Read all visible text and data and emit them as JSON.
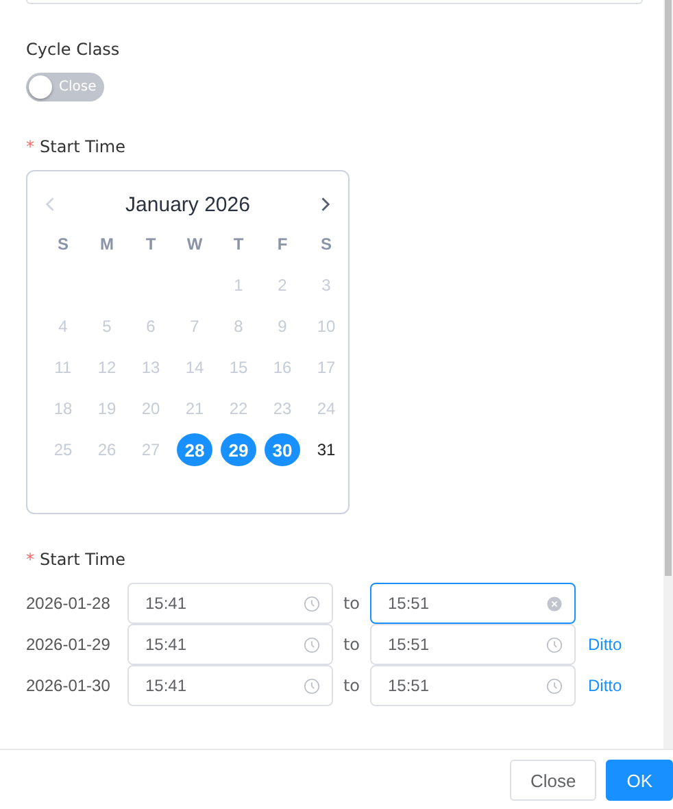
{
  "cycle_class": {
    "label": "Cycle Class",
    "toggle": {
      "label": "Close",
      "on": false
    }
  },
  "start_date": {
    "label": "Start Time",
    "required_mark": "*",
    "calendar": {
      "title": "January 2026",
      "nav": [
        {
          "kind": "prev",
          "disabled": true
        },
        {
          "kind": "next",
          "disabled": false
        }
      ],
      "weekdays": [
        "S",
        "M",
        "T",
        "W",
        "T",
        "F",
        "S"
      ],
      "weeks": [
        [
          {
            "label": "1",
            "selected": false,
            "disabled": true
          },
          {
            "label": "2",
            "selected": false,
            "disabled": true
          },
          {
            "label": "3",
            "selected": false,
            "disabled": true
          }
        ],
        [
          {
            "label": "4",
            "selected": false,
            "disabled": true
          },
          {
            "label": "5",
            "selected": false,
            "disabled": true
          },
          {
            "label": "6",
            "selected": false,
            "disabled": true
          },
          {
            "label": "7",
            "selected": false,
            "disabled": true
          },
          {
            "label": "8",
            "selected": false,
            "disabled": true
          },
          {
            "label": "9",
            "selected": false,
            "disabled": true
          },
          {
            "label": "10",
            "selected": false,
            "disabled": true
          }
        ],
        [
          {
            "label": "11",
            "selected": false,
            "disabled": true
          },
          {
            "label": "12",
            "selected": false,
            "disabled": true
          },
          {
            "label": "13",
            "selected": false,
            "disabled": true
          },
          {
            "label": "14",
            "selected": false,
            "disabled": true
          },
          {
            "label": "15",
            "selected": false,
            "disabled": true
          },
          {
            "label": "16",
            "selected": false,
            "disabled": true
          },
          {
            "label": "17",
            "selected": false,
            "disabled": true
          }
        ],
        [
          {
            "label": "18",
            "selected": false,
            "disabled": true
          },
          {
            "label": "19",
            "selected": false,
            "disabled": true
          },
          {
            "label": "20",
            "selected": false,
            "disabled": true
          },
          {
            "label": "21",
            "selected": false,
            "disabled": true
          },
          {
            "label": "22",
            "selected": false,
            "disabled": true
          },
          {
            "label": "23",
            "selected": false,
            "disabled": true
          },
          {
            "label": "24",
            "selected": false,
            "disabled": true
          }
        ],
        [
          {
            "label": "25",
            "selected": false,
            "disabled": true
          },
          {
            "label": "26",
            "selected": false,
            "disabled": true
          },
          {
            "label": "27",
            "selected": false,
            "disabled": true
          },
          {
            "label": "28",
            "selected": true,
            "disabled": false
          },
          {
            "label": "29",
            "selected": true,
            "disabled": false
          },
          {
            "label": "30",
            "selected": true,
            "disabled": false
          },
          {
            "label": "31",
            "selected": false,
            "disabled": false
          }
        ]
      ]
    }
  },
  "start_time": {
    "label": "Start Time",
    "required_mark": "*",
    "rows": [
      {
        "date": "2026-01-28",
        "from": "15:41",
        "separator": "to",
        "to": "15:51",
        "to_focused": true
      },
      {
        "date": "2026-01-29",
        "from": "15:41",
        "separator": "to",
        "to": "15:51",
        "to_focused": false,
        "link": "Ditto"
      },
      {
        "date": "2026-01-30",
        "from": "15:41",
        "separator": "to",
        "to": "15:51",
        "to_focused": false,
        "link": "Ditto"
      }
    ]
  },
  "buttons": [
    {
      "label": "Close",
      "kind": "default"
    },
    {
      "label": "OK",
      "kind": "primary"
    }
  ]
}
